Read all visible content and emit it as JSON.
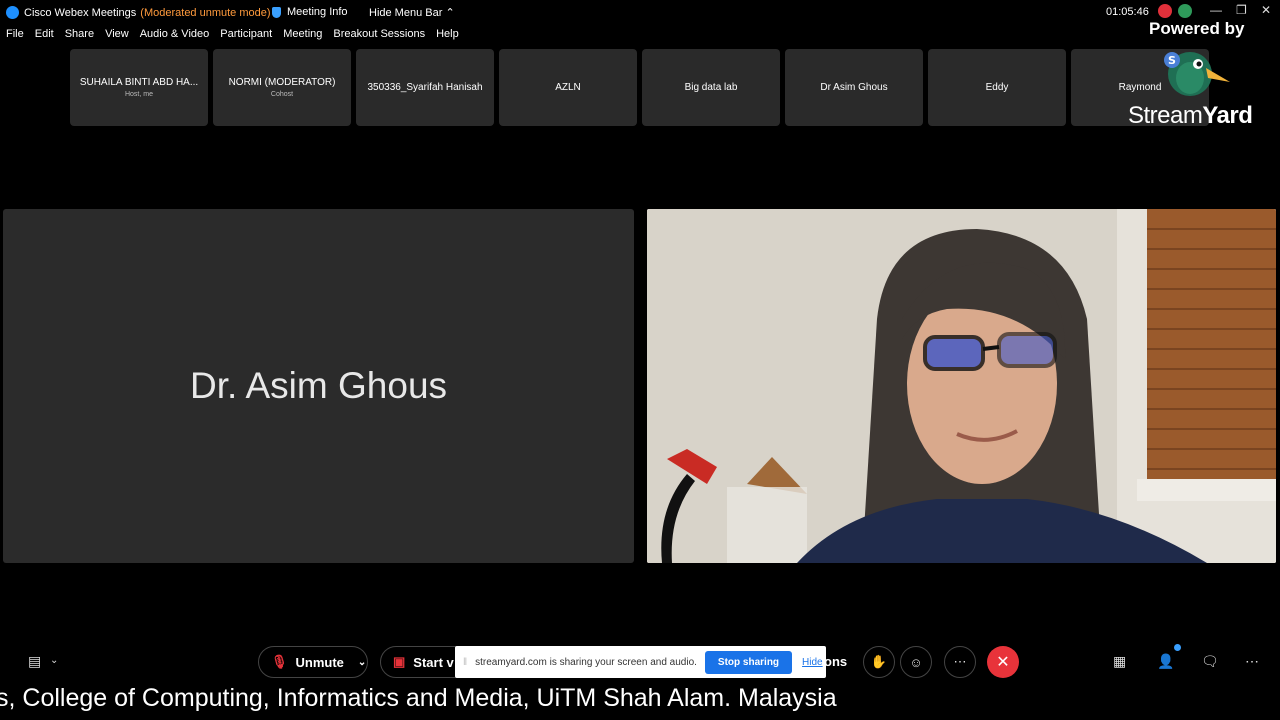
{
  "titlebar": {
    "app_name": "Cisco Webex Meetings",
    "mode": "(Moderated unmute mode)",
    "meeting_info": "Meeting Info",
    "hide_menu_bar": "Hide Menu Bar",
    "clock": "01:05:46"
  },
  "menu": [
    "File",
    "Edit",
    "Share",
    "View",
    "Audio & Video",
    "Participant",
    "Meeting",
    "Breakout Sessions",
    "Help"
  ],
  "participants": [
    {
      "name": "SUHAILA BINTI ABD HA...",
      "role": "Host, me"
    },
    {
      "name": "NORMI (MODERATOR)",
      "role": "Cohost"
    },
    {
      "name": "350336_Syarifah Hanisah",
      "role": ""
    },
    {
      "name": "AZLN",
      "role": ""
    },
    {
      "name": "Big data lab",
      "role": ""
    },
    {
      "name": "Dr Asim Ghous",
      "role": ""
    },
    {
      "name": "Eddy",
      "role": ""
    },
    {
      "name": "Raymond",
      "role": ""
    }
  ],
  "watermark": {
    "powered_by": "Powered by",
    "brand_stream": "Stream",
    "brand_yard": "Yard"
  },
  "main": {
    "active_speaker_name": "Dr. Asim Ghous"
  },
  "controls": {
    "unmute": "Unmute",
    "start_video": "Start v",
    "partial": "ons"
  },
  "share_banner": {
    "message": "streamyard.com is sharing your screen and audio.",
    "stop": "Stop sharing",
    "hide": "Hide"
  },
  "ticker": {
    "text": "s, College of Computing, Informatics and Media, UiTM Shah Alam. Malaysia"
  },
  "colors": {
    "mode_orange": "#ff9a3c",
    "end_call_red": "#e8333a",
    "stop_blue": "#1a73e8"
  }
}
